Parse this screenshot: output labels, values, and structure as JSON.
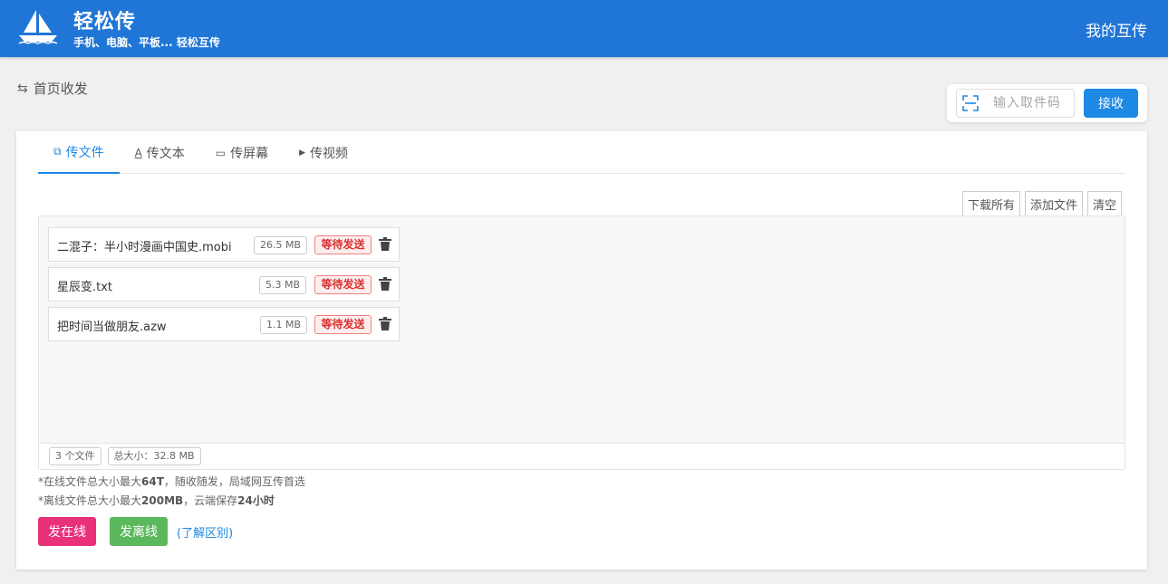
{
  "header": {
    "title": "轻松传",
    "subtitle": "手机、电脑、平板... 轻松互传",
    "my_transfers": "我的互传"
  },
  "breadcrumb": {
    "icon": "⇆",
    "label": "首页收发"
  },
  "receive": {
    "placeholder": "输入取件码",
    "button": "接收"
  },
  "tabs": [
    {
      "icon": "⧉",
      "label": "传文件"
    },
    {
      "icon": "A",
      "label": "传文本"
    },
    {
      "icon": "▭",
      "label": "传屏幕"
    },
    {
      "icon": "▶",
      "label": "传视频"
    }
  ],
  "actions": {
    "download_all": "下载所有",
    "add_file": "添加文件",
    "clear": "清空"
  },
  "files": [
    {
      "name": "二混子：半小时漫画中国史.mobi",
      "size": "26.5 MB",
      "status": "等待发送"
    },
    {
      "name": "星辰变.txt",
      "size": "5.3 MB",
      "status": "等待发送"
    },
    {
      "name": "把时间当做朋友.azw",
      "size": "1.1 MB",
      "status": "等待发送"
    }
  ],
  "summary": {
    "count": "3 个文件",
    "total": "总大小：32.8 MB"
  },
  "notes": {
    "online_prefix": "*在线文件总大小最大",
    "online_limit": "64T",
    "online_suffix": "，随收随发，局域网互传首选",
    "offline_prefix": "*离线文件总大小最大",
    "offline_limit": "200MB",
    "offline_mid": "，云端保存",
    "offline_time": "24小时"
  },
  "buttons": {
    "send_online": "发在线",
    "send_offline": "发离线",
    "learn_diff": "(了解区别)"
  },
  "colors": {
    "header_bg": "#2076d6",
    "primary": "#1e88e5",
    "online": "#e9317a",
    "offline": "#5cb85c",
    "status": "#d9302f"
  }
}
